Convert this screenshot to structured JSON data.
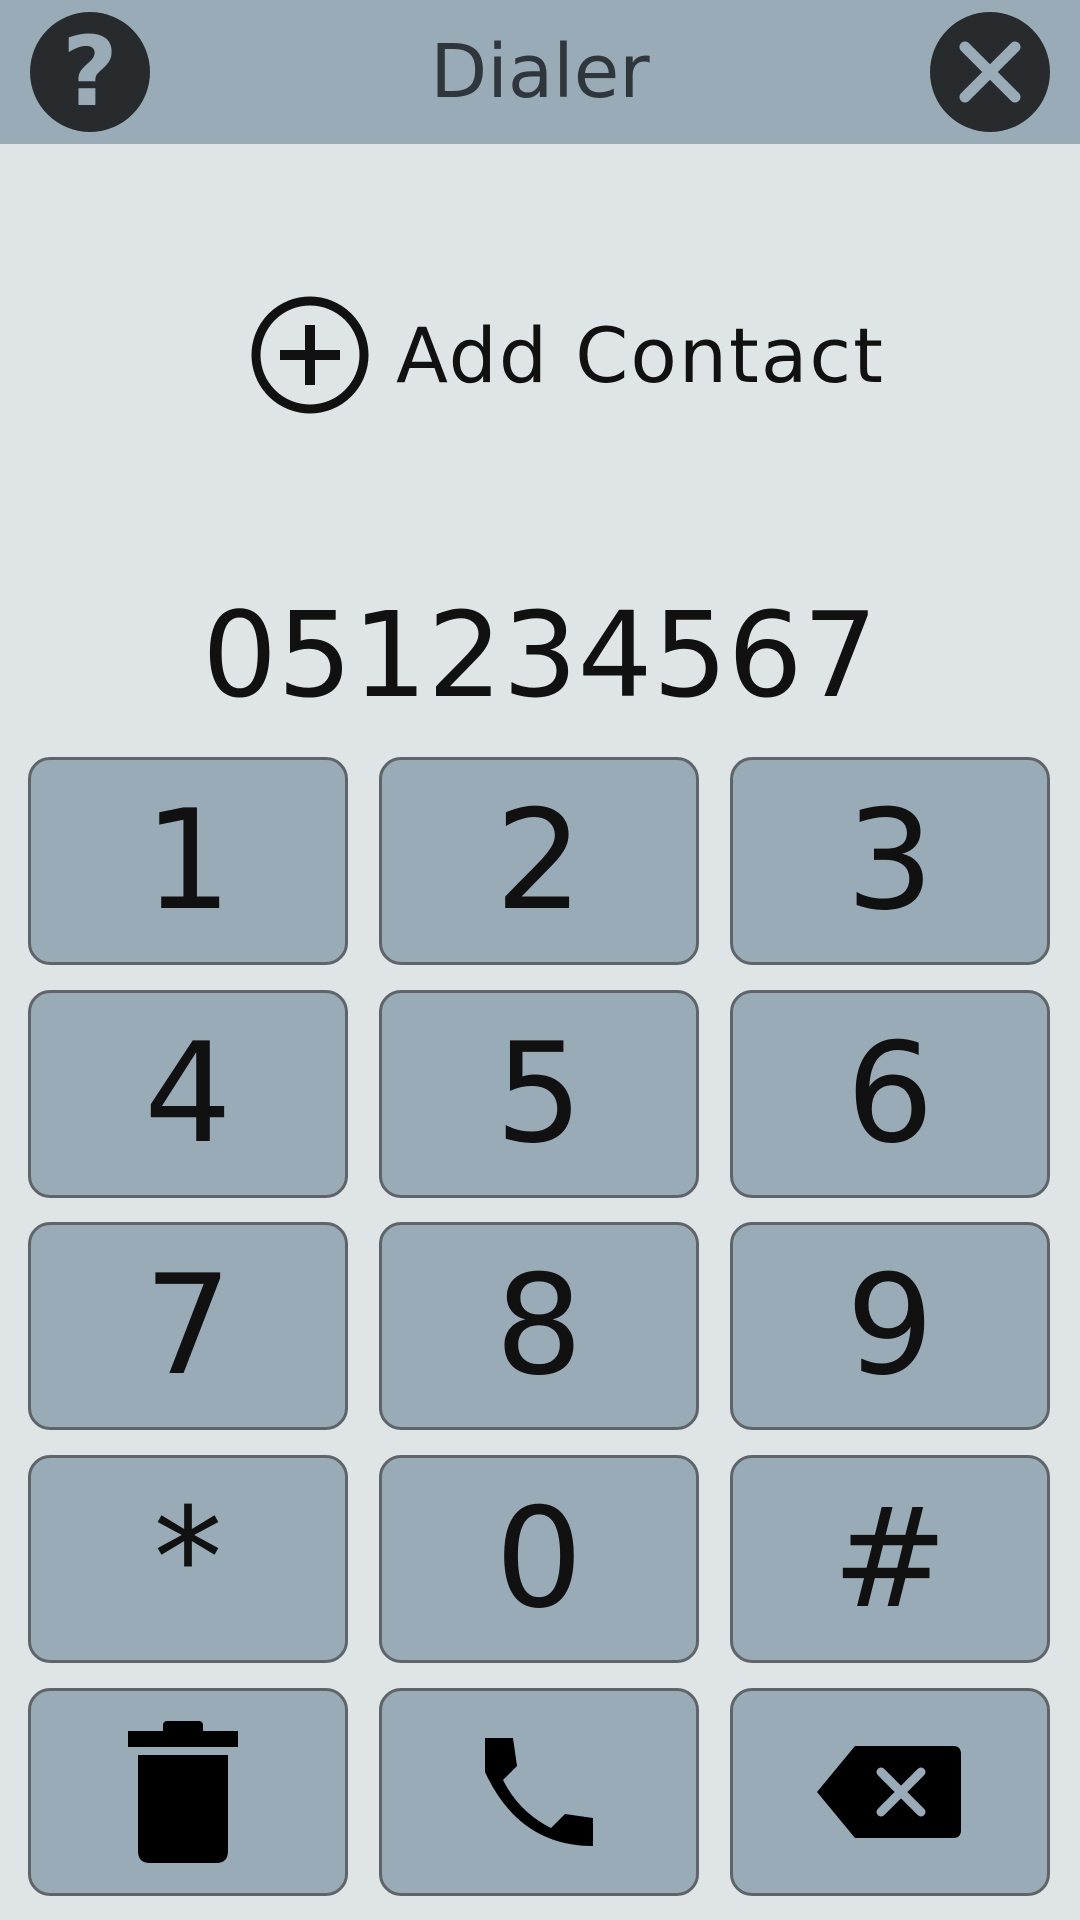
{
  "header": {
    "title": "Dialer",
    "help_glyph": "?",
    "help_icon": "question-icon",
    "close_icon": "close-icon",
    "bar_color": "#9aabb8",
    "button_color": "#272b2e"
  },
  "add_contact": {
    "label": "Add Contact",
    "icon": "plus-circle-icon"
  },
  "display": {
    "number": "051234567"
  },
  "keypad": {
    "keys": [
      "1",
      "2",
      "3",
      "4",
      "5",
      "6",
      "7",
      "8",
      "9",
      "*",
      "0",
      "#"
    ],
    "actions": {
      "delete_icon": "trash-icon",
      "call_icon": "phone-icon",
      "backspace_icon": "backspace-icon"
    },
    "key_color": "#9aabb8"
  }
}
